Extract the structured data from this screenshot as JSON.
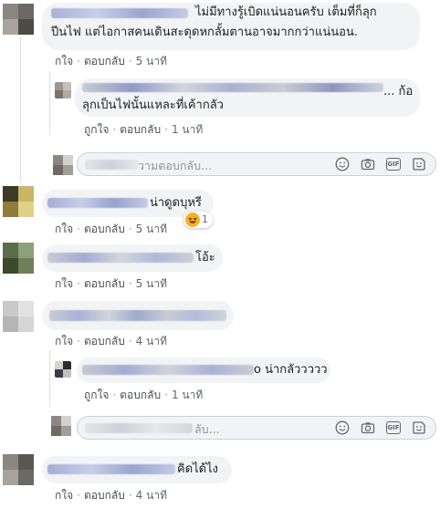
{
  "actions": {
    "like": "ถูกใจ",
    "reply": "ตอบกลับ",
    "like_short": "กใจ"
  },
  "composer": {
    "placeholder_tail": "วามตอบกลับ...",
    "placeholder_tail2": "ลับ..."
  },
  "comments": [
    {
      "text_line1": "ไม่มีทางรู้เบิดแน่นอนครับ เต็มที่ก็ลุก",
      "text_line2": "ปีนไฟ แต่ไอกาสคนเดินสะดุดหกลั้มตานอาจมากกว่าแน่นอน.",
      "time": "5 นาที"
    },
    {
      "text_line1": "... ก้อ",
      "text_line2": "ลุกเป็นไฟนั้นแหละที่เค้ากลัว",
      "time": "1 นาที",
      "reply": true
    },
    {
      "text": "น่าดูดบุหรี",
      "time": "5 นาที",
      "reaction_count": "1"
    },
    {
      "text": "โอ้ะ",
      "time": "5 นาที"
    },
    {
      "text": "",
      "time": "4 นาที"
    },
    {
      "text": "o น่ากลัววววว",
      "time": "1 นาที",
      "reply": true
    },
    {
      "text": "คิดได้ไง",
      "time": "4 นาที"
    }
  ],
  "colors": {
    "bubble": "#f2f3f5",
    "link": "#4b4f56",
    "muted": "#616770",
    "emoji": "#f7b125"
  },
  "icons": [
    "emoji-icon",
    "camera-icon",
    "gif-icon",
    "sticker-icon"
  ]
}
